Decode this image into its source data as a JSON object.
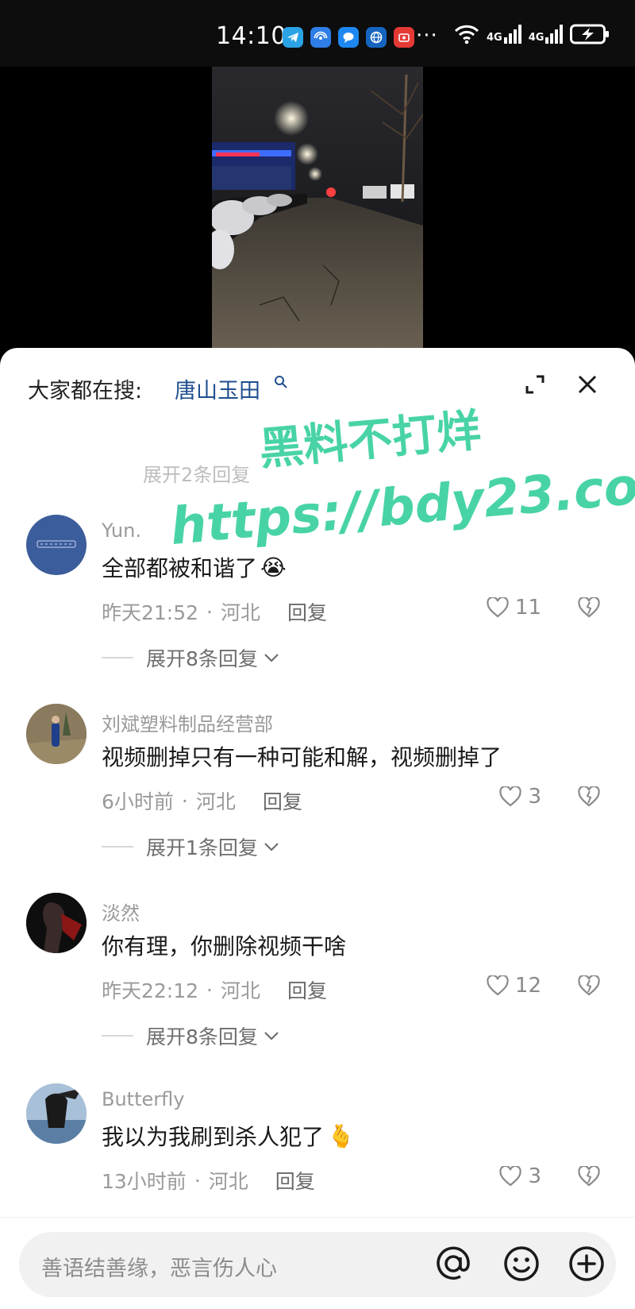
{
  "status_bar": {
    "time": "14:10",
    "notification_icons": [
      "telegram-icon",
      "wireless-share-icon",
      "chat-bubble-icon",
      "globe-app-icon",
      "red-app-icon"
    ],
    "more": "···",
    "network": [
      "4G",
      "4G"
    ]
  },
  "trending": {
    "prefix": "大家都在搜:",
    "term": "唐山玉田"
  },
  "faded_reply": "展开2条回复",
  "watermark": {
    "line1": "黑料不打烊",
    "line2": "https://bdy23.co"
  },
  "comments": [
    {
      "author": "Yun.",
      "text": "全部都被和谐了",
      "emoji": "😭",
      "time": "昨天21:52",
      "location": "河北",
      "reply_label": "回复",
      "likes": "11",
      "expand": "展开8条回复"
    },
    {
      "author": "刘斌塑料制品经营部",
      "text": "视频删掉只有一种可能和解，视频删掉了",
      "emoji": "",
      "time": "6小时前",
      "location": "河北",
      "reply_label": "回复",
      "likes": "3",
      "expand": "展开1条回复"
    },
    {
      "author": "淡然",
      "text": "你有理，你删除视频干啥",
      "emoji": "",
      "time": "昨天22:12",
      "location": "河北",
      "reply_label": "回复",
      "likes": "12",
      "expand": "展开8条回复"
    },
    {
      "author": "Butterfly",
      "text": "我以为我刷到杀人犯了",
      "emoji": "🫰",
      "time": "13小时前",
      "location": "河北",
      "reply_label": "回复",
      "likes": "3",
      "expand": ""
    }
  ],
  "input": {
    "placeholder": "善语结善缘，恶言伤人心"
  },
  "colors": {
    "trend_term": "#1f4f8f",
    "watermark": "#48d3a6",
    "muted_text": "#9a9a9a"
  }
}
